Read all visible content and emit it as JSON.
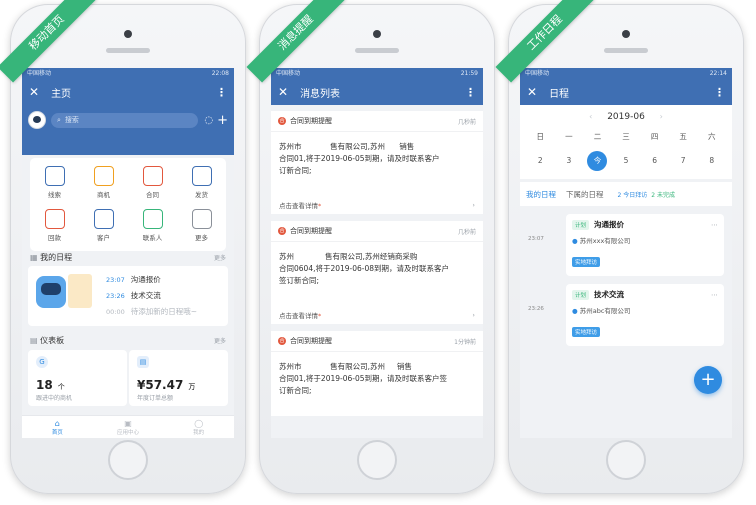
{
  "phones": [
    {
      "ribbon": "移动首页",
      "status_time": "22:08",
      "status_carrier": "中国移动",
      "nav_title": "主页",
      "search_placeholder": "搜索",
      "shortcuts": [
        {
          "label": "线索",
          "icon": "link-icon",
          "color": "#3f6fb3"
        },
        {
          "label": "商机",
          "icon": "dollar-icon",
          "color": "#f0a020"
        },
        {
          "label": "合同",
          "icon": "document-icon",
          "color": "#e2583e"
        },
        {
          "label": "发货",
          "icon": "truck-icon",
          "color": "#3f6fb3"
        },
        {
          "label": "回款",
          "icon": "yen-icon",
          "color": "#e2583e"
        },
        {
          "label": "客户",
          "icon": "person-icon",
          "color": "#3f6fb3"
        },
        {
          "label": "联系人",
          "icon": "contact-icon",
          "color": "#37b57a"
        },
        {
          "label": "更多",
          "icon": "grid-icon",
          "color": "#8a9099"
        }
      ],
      "schedule_title": "我的日程",
      "schedule_more": "更多",
      "schedule_items": [
        {
          "time": "23:07",
          "text": "沟通报价"
        },
        {
          "time": "23:26",
          "text": "技术交流"
        },
        {
          "time": "00:00",
          "text": "待添加新的日程哦~"
        }
      ],
      "dashboard_title": "仪表板",
      "dashboard_more": "更多",
      "stat1_value": "18",
      "stat1_unit": "个",
      "stat1_label": "跟进中的商机",
      "stat2_value": "¥57.47",
      "stat2_unit": "万",
      "stat2_label": "年度订单总额",
      "bottom_nav": [
        "首页",
        "应用中心",
        "我的"
      ]
    },
    {
      "ribbon": "消息提醒",
      "status_time": "21:59",
      "status_carrier": "中国移动",
      "nav_title": "消息列表",
      "messages": [
        {
          "title": "合同到期提醒",
          "time": "几秒前",
          "line1": "苏州市            售有限公司,苏州      销售",
          "line2": "合同01,将于2019-06-05到期，请及时联系客户",
          "line3": "订新合同;",
          "footer": "点击查看详情"
        },
        {
          "title": "合同到期提醒",
          "time": "几秒前",
          "line1": "苏州             售有限公司,苏州经销商采购",
          "line2": "合同0604,将于2019-06-08到期，请及时联系客户",
          "line3": "签订新合同;",
          "footer": "点击查看详情"
        },
        {
          "title": "合同到期提醒",
          "time": "1分钟前",
          "line1": "苏州市            售有限公司,苏州     销售",
          "line2": "合同01,将于2019-06-05到期，请及时联系客户签",
          "line3": "订新合同;",
          "footer": ""
        }
      ]
    },
    {
      "ribbon": "工作日程",
      "status_time": "22:14",
      "status_carrier": "中国移动",
      "nav_title": "日程",
      "month": "2019-06",
      "weekdays": [
        "日",
        "一",
        "二",
        "三",
        "四",
        "五",
        "六"
      ],
      "days": [
        "2",
        "3",
        "今",
        "5",
        "6",
        "7",
        "8"
      ],
      "tab_mine": "我的日程",
      "tab_subordinate": "下属的日程",
      "legend1": "2 今日拜访",
      "legend2": "2 未完成",
      "events": [
        {
          "time": "23:07",
          "badge": "计划",
          "title": "沟通报价",
          "company": "苏州xxx有限公司",
          "tag": "实地拜访"
        },
        {
          "time": "23:26",
          "badge": "计划",
          "title": "技术交流",
          "company": "苏州abc有限公司",
          "tag": "实地拜访"
        }
      ],
      "fab": "+"
    }
  ]
}
